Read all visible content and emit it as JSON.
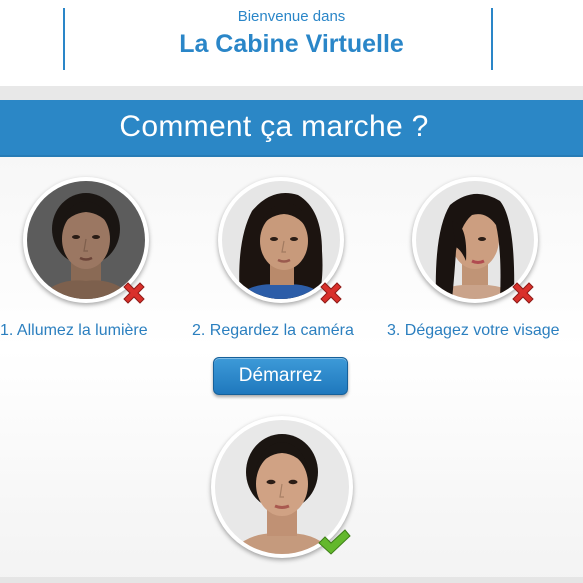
{
  "header": {
    "welcome": "Bienvenue dans",
    "title": "La Cabine Virtuelle"
  },
  "banner": {
    "heading": "Comment ça marche ?"
  },
  "steps": [
    {
      "label": "1. Allumez la lumière",
      "status": "error",
      "status_icon": "red-x-icon"
    },
    {
      "label": "2. Regardez la caméra",
      "status": "error",
      "status_icon": "red-x-icon"
    },
    {
      "label": "3. Dégagez votre visage",
      "status": "error",
      "status_icon": "red-x-icon"
    }
  ],
  "start_button": {
    "label": "Démarrez"
  },
  "result": {
    "status": "ok",
    "status_icon": "green-check-icon"
  },
  "colors": {
    "accent": "#2b87c6",
    "text_blue": "#2b7fbf",
    "error_red": "#d9302b",
    "ok_green": "#63b82c"
  }
}
